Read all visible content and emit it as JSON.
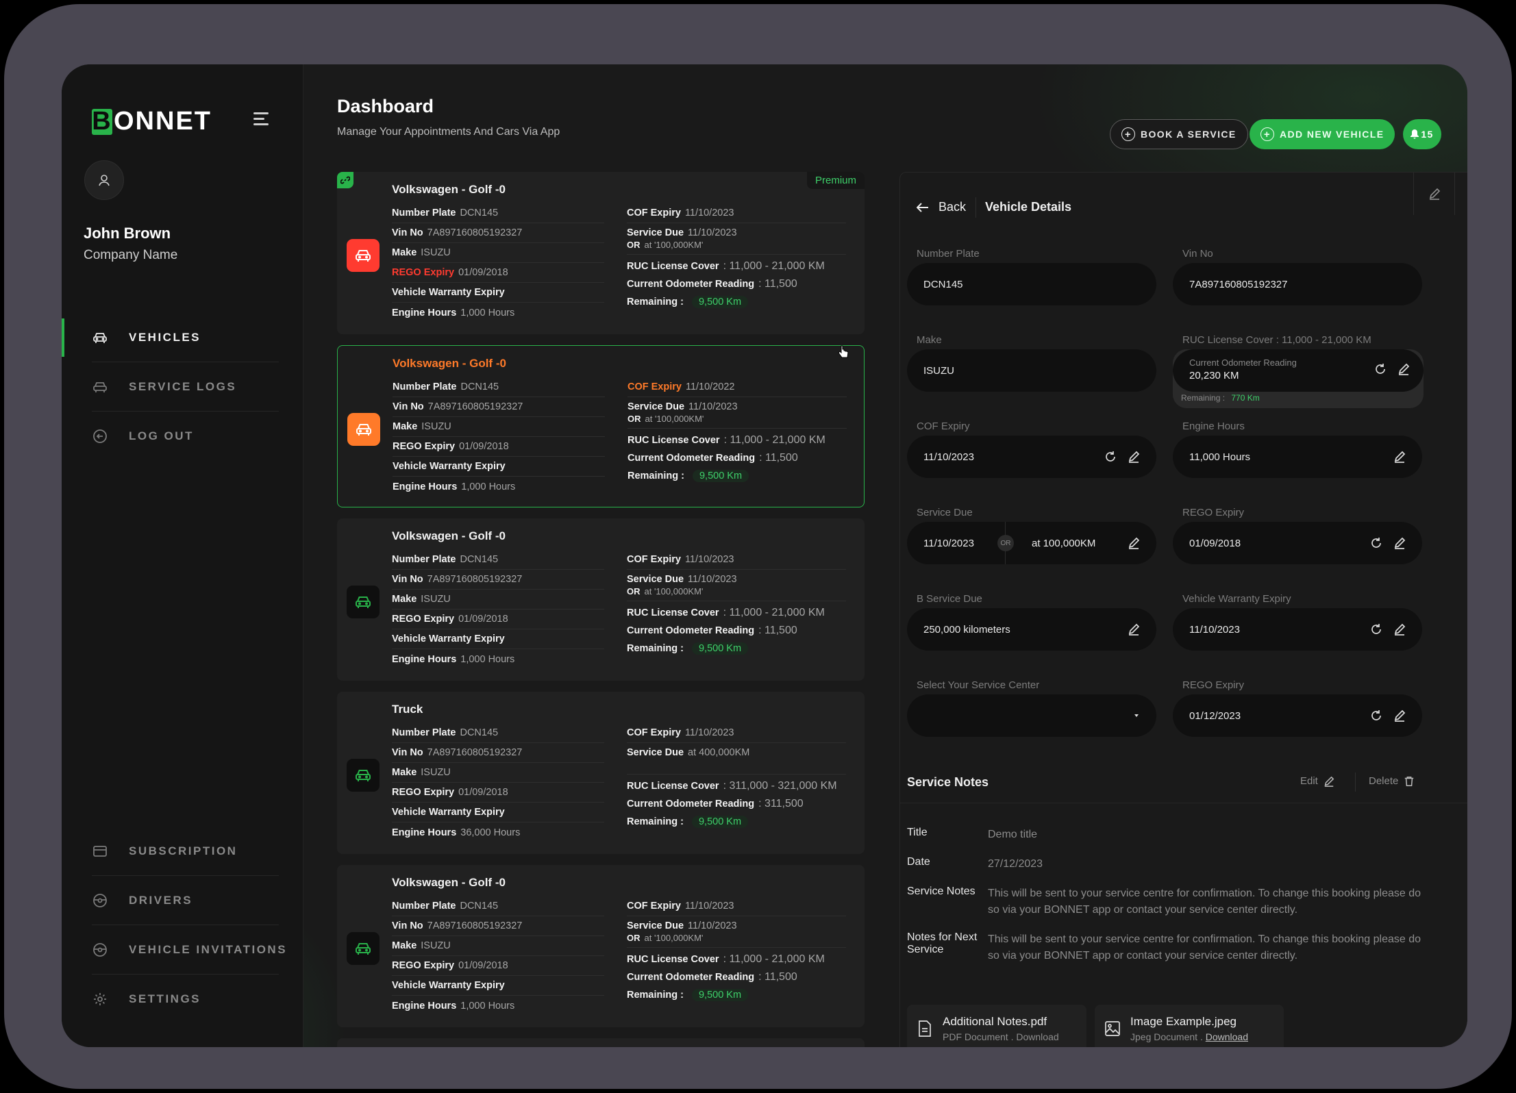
{
  "brand": {
    "logo_letter": "B",
    "logo_rest": "ONNET",
    "accent": "#29b34a"
  },
  "user": {
    "name": "John Brown",
    "company": "Company Name"
  },
  "nav": {
    "top": [
      {
        "label": "VEHICLES"
      },
      {
        "label": "SERVICE LOGS"
      },
      {
        "label": "LOG OUT"
      }
    ],
    "bottom": [
      {
        "label": "SUBSCRIPTION"
      },
      {
        "label": "DRIVERS"
      },
      {
        "label": "VEHICLE INVITATIONS"
      },
      {
        "label": "SETTINGS"
      }
    ]
  },
  "header": {
    "title": "Dashboard",
    "subtitle": "Manage Your Appointments And Cars Via App",
    "book_label": "BOOK A SERVICE",
    "add_label": "ADD NEW VEHICLE",
    "notif_count": "15"
  },
  "labels": {
    "number_plate": "Number Plate",
    "vin": "Vin No",
    "make": "Make",
    "rego": "REGO Expiry",
    "warranty": "Vehicle Warranty Expiry",
    "engine": "Engine Hours",
    "cof": "COF Expiry",
    "service_due": "Service Due",
    "or": "OR",
    "ruc": "RUC License Cover",
    "odometer": "Current Odometer Reading",
    "remaining": "Remaining :",
    "premium": "Premium"
  },
  "vehicles": [
    {
      "name": "Volkswagen - Golf -0",
      "plate": "DCN145",
      "vin": "7A897160805192327",
      "make": "ISUZU",
      "rego": "01/09/2018",
      "engine": "1,000 Hours",
      "cof": "11/10/2023",
      "service": "11/10/2023",
      "or": "at '100,000KM'",
      "ruc": ": 11,000 - 21,000 KM",
      "odo": ": 11,500",
      "remaining": "9,500 Km",
      "premium": true,
      "icon_color": "#ff3b30",
      "rego_alert": true
    },
    {
      "name": "Volkswagen - Golf -0",
      "plate": "DCN145",
      "vin": "7A897160805192327",
      "make": "ISUZU",
      "rego": "01/09/2018",
      "engine": "1,000 Hours",
      "cof": "11/10/2022",
      "service": "11/10/2023",
      "or": "at '100,000KM'",
      "ruc": ": 11,000 - 21,000 KM",
      "odo": ": 11,500",
      "remaining": "9,500 Km",
      "icon_color": "#ff7a29",
      "cof_alert": true,
      "selected": true
    },
    {
      "name": "Volkswagen - Golf -0",
      "plate": "DCN145",
      "vin": "7A897160805192327",
      "make": "ISUZU",
      "rego": "01/09/2018",
      "engine": "1,000 Hours",
      "cof": "11/10/2023",
      "service": "11/10/2023",
      "or": "at '100,000KM'",
      "ruc": ": 11,000 - 21,000 KM",
      "odo": ": 11,500",
      "remaining": "9,500 Km",
      "icon_color": "#29b34a"
    },
    {
      "name": "Truck",
      "plate": "DCN145",
      "vin": "7A897160805192327",
      "make": "ISUZU",
      "rego": "01/09/2018",
      "engine": "36,000 Hours",
      "cof": "11/10/2023",
      "service": "at 400,000KM",
      "ruc": ": 311,000 - 321,000 KM",
      "odo": ": 311,500",
      "remaining": "9,500 Km",
      "icon_color": "#29b34a",
      "truck": true
    },
    {
      "name": "Volkswagen - Golf -0",
      "plate": "DCN145",
      "vin": "7A897160805192327",
      "make": "ISUZU",
      "rego": "01/09/2018",
      "engine": "1,000 Hours",
      "cof": "11/10/2023",
      "service": "11/10/2023",
      "or": "at '100,000KM'",
      "ruc": ": 11,000 - 21,000 KM",
      "odo": ": 11,500",
      "remaining": "9,500 Km",
      "icon_color": "#29b34a"
    }
  ],
  "details": {
    "back": "Back",
    "title": "Vehicle Details",
    "fields": {
      "plate": {
        "label": "Number Plate",
        "value": "DCN145"
      },
      "vin": {
        "label": "Vin No",
        "value": "7A897160805192327"
      },
      "make": {
        "label": "Make",
        "value": "ISUZU"
      },
      "ruc": {
        "label": "RUC License Cover : 11,000 - 21,000 KM",
        "sub": "Current Odometer Reading",
        "value": "20,230 KM",
        "remaining_label": "Remaining :",
        "remaining": "770 Km"
      },
      "cof": {
        "label": "COF Expiry",
        "value": "11/10/2023"
      },
      "engine": {
        "label": "Engine Hours",
        "value": "11,000 Hours"
      },
      "service": {
        "label": "Service Due",
        "value": "11/10/2023",
        "or": "OR",
        "km": "at 100,000KM"
      },
      "rego": {
        "label": "REGO Expiry",
        "value": "01/09/2018"
      },
      "bservice": {
        "label": "B Service Due",
        "value": "250,000 kilometers"
      },
      "warranty": {
        "label": "Vehicle Warranty Expiry",
        "value": "11/10/2023"
      },
      "center": {
        "label": "Select Your Service Center",
        "value": ""
      },
      "rego2": {
        "label": "REGO Expiry",
        "value": "01/12/2023"
      }
    },
    "notes": {
      "title": "Service Notes",
      "edit": "Edit",
      "delete": "Delete",
      "rows": [
        {
          "k": "Title",
          "v": "Demo title"
        },
        {
          "k": "Date",
          "v": "27/12/2023"
        },
        {
          "k": "Service Notes",
          "v": "This will be sent to your service centre for confirmation. To change this booking please do so via your BONNET app or contact your service center directly."
        },
        {
          "k": "Notes for Next Service",
          "v": "This will be sent to your service centre for confirmation. To change this booking please do so via your BONNET app or contact your service center directly."
        }
      ]
    },
    "files": [
      {
        "name": "Additional Notes.pdf",
        "type": "PDF Document .",
        "action": "Download",
        "icon": "document-icon"
      },
      {
        "name": "Image Example.jpeg",
        "type": "Jpeg Document .",
        "action": "Download",
        "icon": "image-icon"
      }
    ]
  }
}
